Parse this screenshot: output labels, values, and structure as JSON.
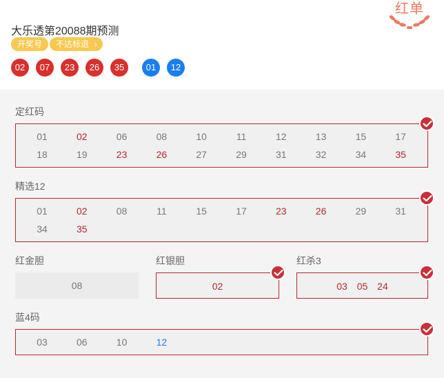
{
  "header": {
    "title": "大乐透第20088期预测",
    "tags": [
      "开奖号",
      "不达标退"
    ],
    "red_balls": [
      "02",
      "07",
      "23",
      "26",
      "35"
    ],
    "blue_balls": [
      "01",
      "12"
    ],
    "stamp": "红单"
  },
  "sections": {
    "dinghong": {
      "label": "定红码",
      "rows": [
        [
          "01",
          "02",
          "06",
          "08",
          "10",
          "11",
          "12",
          "13",
          "15",
          "17"
        ],
        [
          "18",
          "19",
          "23",
          "26",
          "27",
          "29",
          "31",
          "32",
          "34",
          "35"
        ]
      ],
      "hits": [
        "02",
        "23",
        "26",
        "35"
      ]
    },
    "jingxuan": {
      "label": "精选12",
      "rows": [
        [
          "01",
          "02",
          "08",
          "11",
          "15",
          "17",
          "23",
          "26",
          "29",
          "31"
        ],
        [
          "34",
          "35"
        ]
      ],
      "hits": [
        "02",
        "23",
        "26",
        "35"
      ]
    },
    "jindan": {
      "label": "红金胆",
      "value": "08"
    },
    "yindan": {
      "label": "红银胆",
      "value": "02"
    },
    "sha": {
      "label": "红杀3",
      "values": [
        "03",
        "05",
        "24"
      ]
    },
    "lan": {
      "label": "蓝4码",
      "values": [
        "03",
        "06",
        "10",
        "12"
      ],
      "hits": [
        "12"
      ]
    }
  },
  "colors": {
    "red": "#d8302d",
    "blue": "#1a7ef0",
    "tag": "#f8c850",
    "stamp": "#ee7a62",
    "border": "#b3282d"
  }
}
